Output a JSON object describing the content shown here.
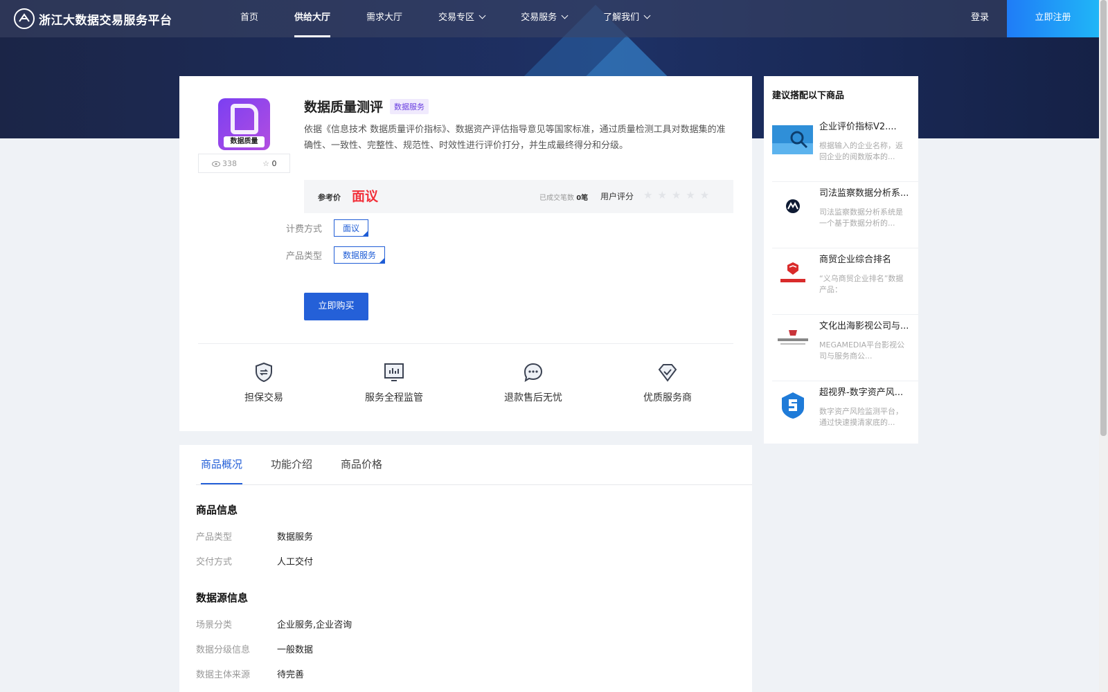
{
  "header": {
    "logo_text": "浙江大数据交易服务平台",
    "nav": [
      {
        "label": "首页"
      },
      {
        "label": "供给大厅"
      },
      {
        "label": "需求大厅"
      },
      {
        "label": "交易专区"
      },
      {
        "label": "交易服务"
      },
      {
        "label": "了解我们"
      }
    ],
    "login": "登录",
    "register": "立即注册"
  },
  "product": {
    "logo_caption": "数据质量",
    "views": "338",
    "favorites": "0",
    "title": "数据质量测评",
    "badge": "数据服务",
    "description": "依据《信息技术 数据质量评价指标》、数据资产评估指导意见等国家标准，通过质量检测工具对数据集的准确性、一致性、完整性、规范性、时效性进行评价打分，并生成最终得分和分级。",
    "price_label": "参考价",
    "price_value": "面议",
    "deal_label": "已成交笔数",
    "deal_count": "0笔",
    "rating_label": "用户评分",
    "rating": 0,
    "stars": "★★★★★",
    "billing_label": "计费方式",
    "billing_value": "面议",
    "type_label": "产品类型",
    "type_value": "数据服务",
    "buy_button": "立即购买"
  },
  "guarantees": [
    {
      "label": "担保交易",
      "icon": "shield-exchange-icon"
    },
    {
      "label": "服务全程监管",
      "icon": "monitor-chart-icon"
    },
    {
      "label": "退款售后无忧",
      "icon": "chat-bubble-icon"
    },
    {
      "label": "优质服务商",
      "icon": "diamond-check-icon"
    }
  ],
  "tabs": [
    {
      "label": "商品概况"
    },
    {
      "label": "功能介绍"
    },
    {
      "label": "商品价格"
    }
  ],
  "info": {
    "section1": "商品信息",
    "rows1": [
      {
        "k": "产品类型",
        "v": "数据服务"
      },
      {
        "k": "交付方式",
        "v": "人工交付"
      }
    ],
    "section2": "数据源信息",
    "rows2": [
      {
        "k": "场景分类",
        "v": "企业服务,企业咨询"
      },
      {
        "k": "数据分级信息",
        "v": "一般数据"
      },
      {
        "k": "数据主体来源",
        "v": "待完善"
      }
    ]
  },
  "recommend": {
    "title": "建议搭配以下商品",
    "items": [
      {
        "name": "企业评价指标V2....",
        "desc": "根据输入的企业名称，返回企业的阅数版本的..."
      },
      {
        "name": "司法监察数据分析系...",
        "desc": "司法监察数据分析系统是一个基于数据分析的..."
      },
      {
        "name": "商贸企业综合排名",
        "desc": "“义乌商贸企业排名”数据产品："
      },
      {
        "name": "文化出海影视公司与...",
        "desc": "MEGAMEDIA平台影视公司与服务商公..."
      },
      {
        "name": "超视界-数字资产风...",
        "desc": "数字资产风险监测平台，通过快速摸清家底的..."
      }
    ]
  },
  "colors": {
    "primary": "#2460d8",
    "price_red": "#f2303a",
    "header_dark": "#1b2547"
  }
}
